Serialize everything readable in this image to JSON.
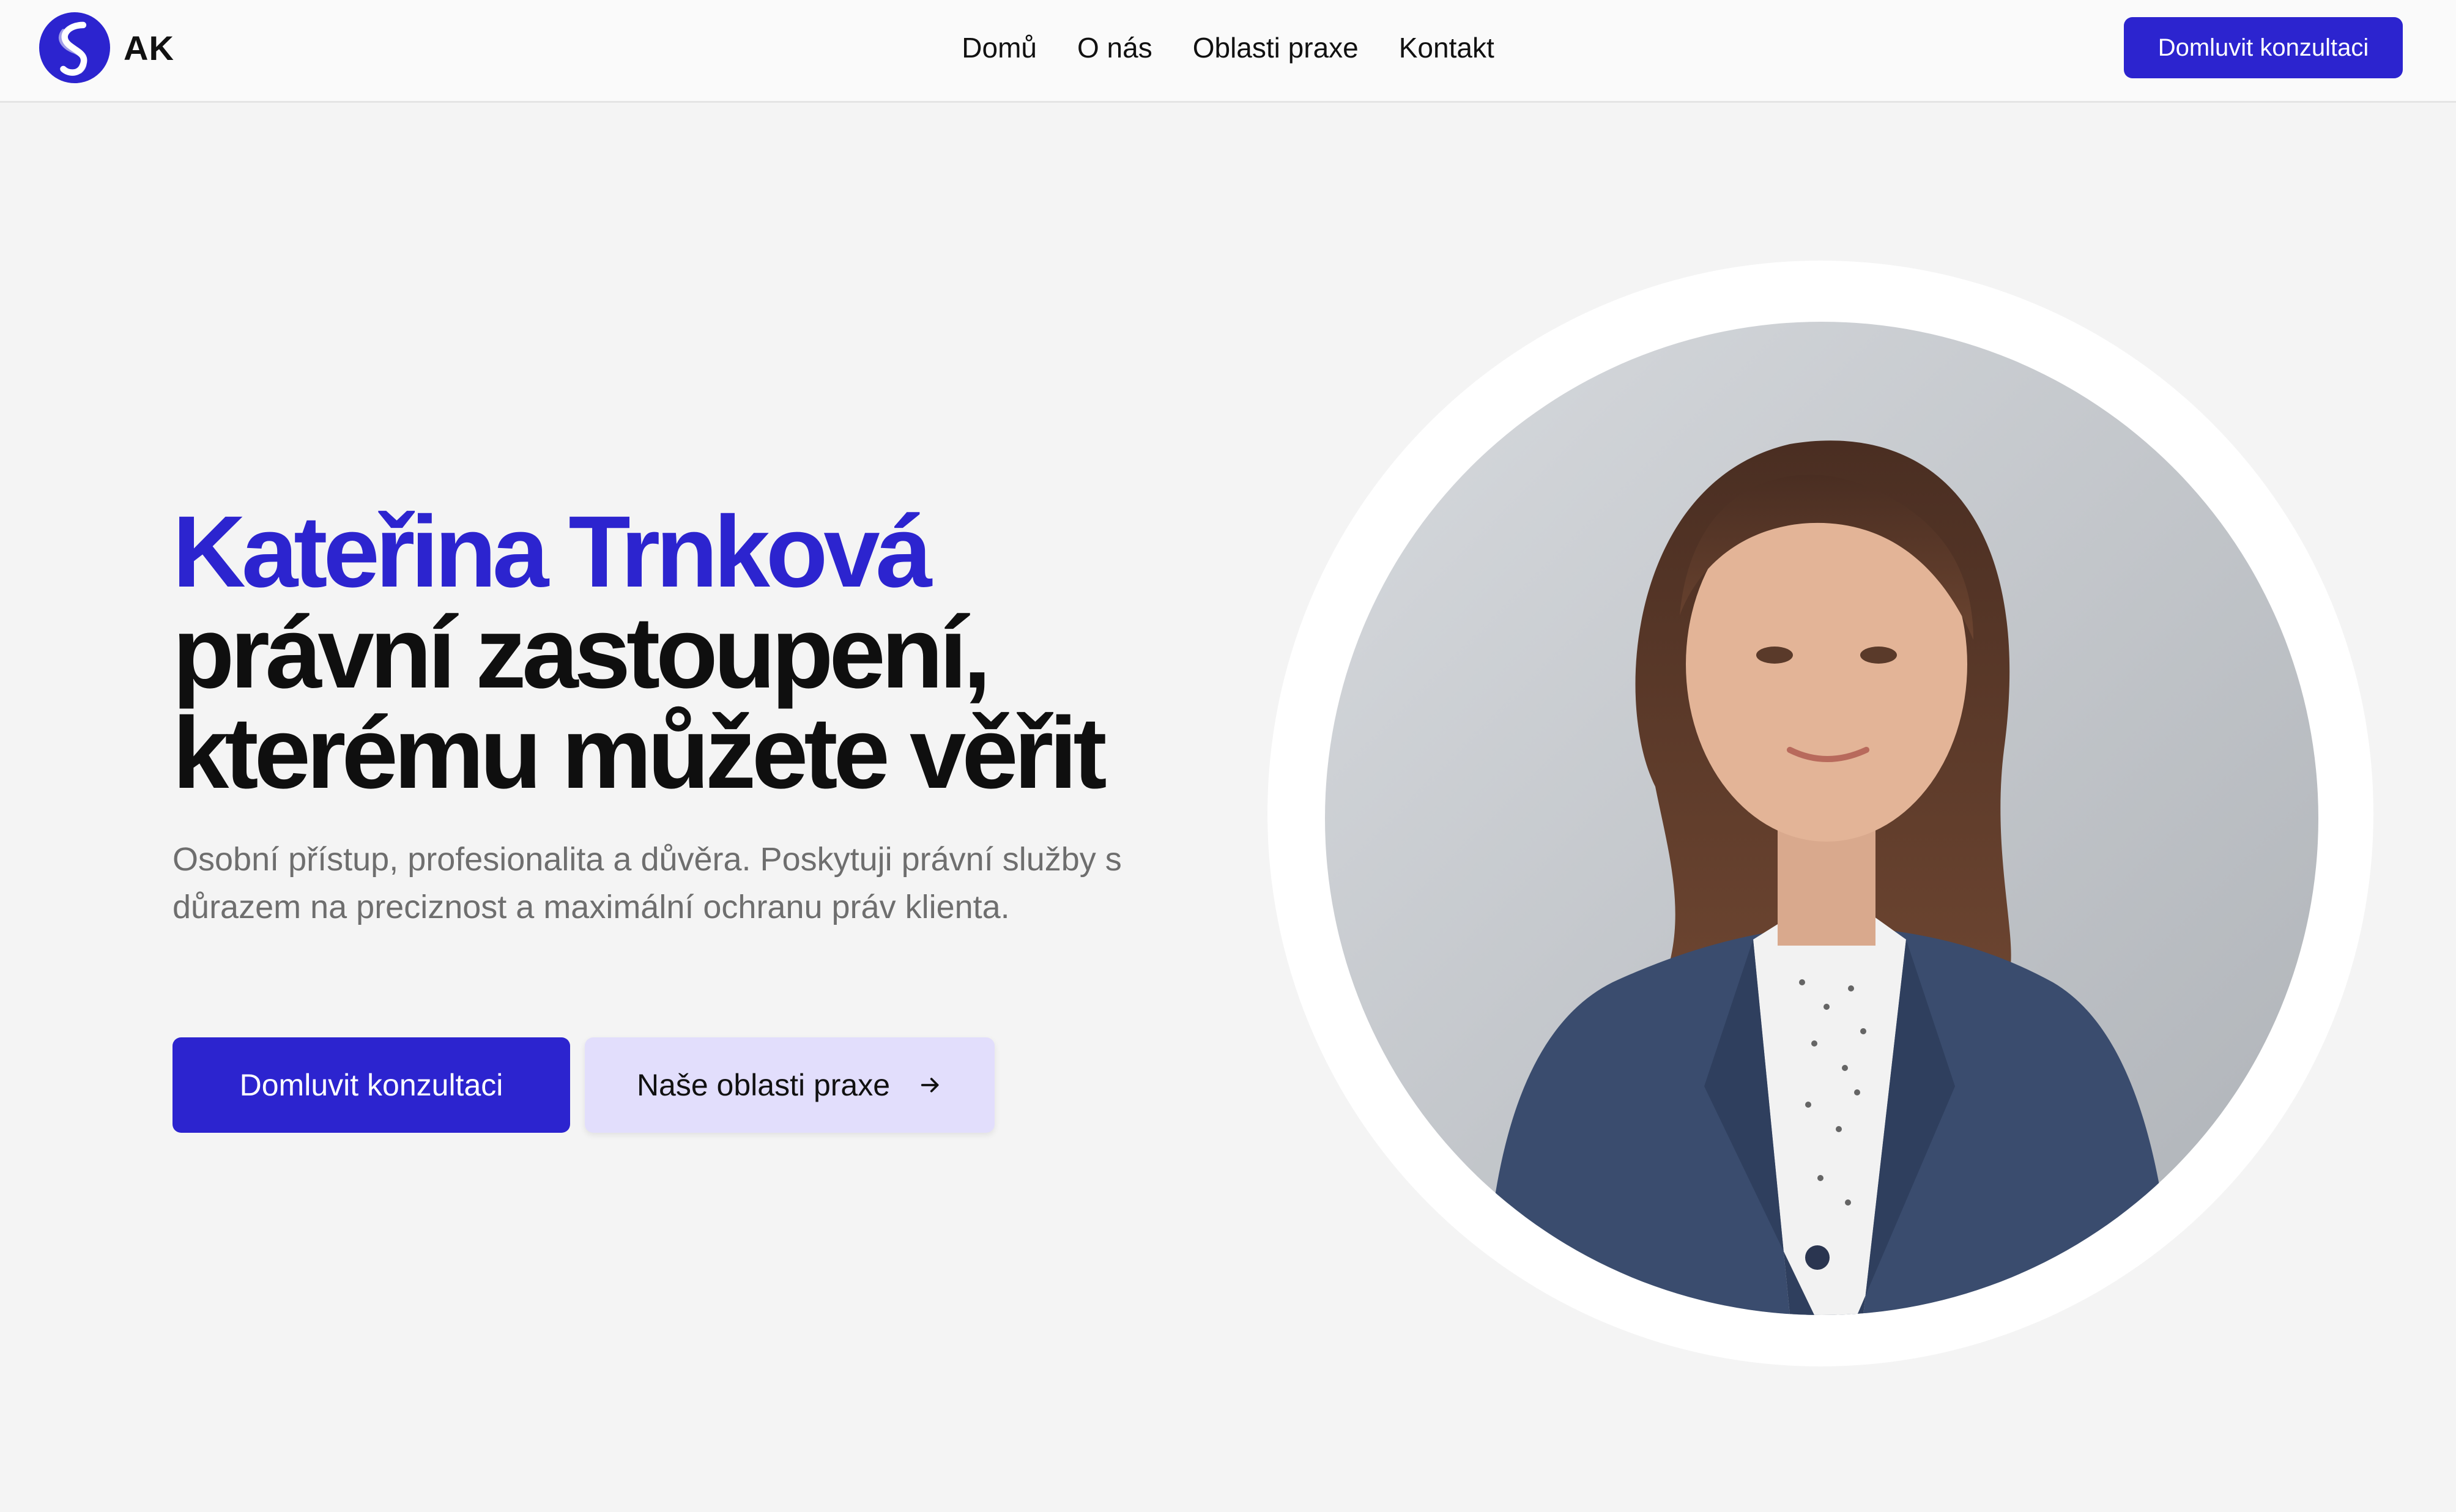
{
  "header": {
    "logo_text": "AK",
    "nav": [
      "Domů",
      "O nás",
      "Oblasti praxe",
      "Kontakt"
    ],
    "cta_label": "Domluvit konzultaci"
  },
  "hero": {
    "name": "Kateřina Trnková",
    "headline_line1": "právní zastoupení,",
    "headline_line2": "kterému můžete věřit",
    "subtitle": "Osobní přístup, profesionalita a důvěra. Poskytuji právní služby s důrazem na preciznost a maximální ochranu práv klienta.",
    "primary_button": "Domluvit konzultaci",
    "secondary_button": "Naše oblasti praxe",
    "secondary_icon": "arrow-right-icon"
  },
  "colors": {
    "accent": "#2c24cf",
    "secondary_button_bg": "#e2defc",
    "page_bg": "#f4f4f4",
    "muted_text": "#6e6e6e"
  }
}
